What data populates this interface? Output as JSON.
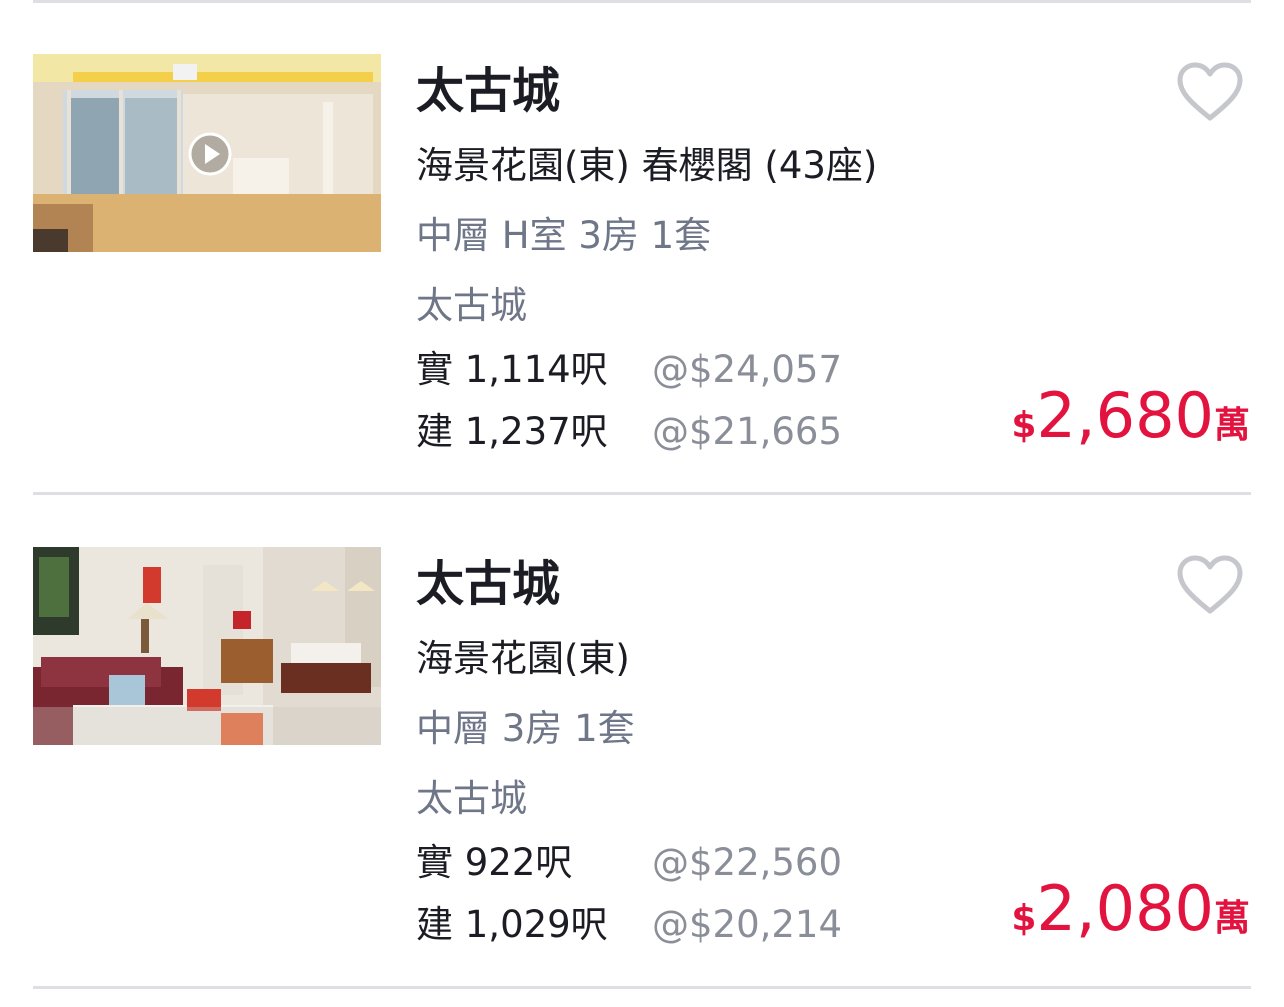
{
  "listings": [
    {
      "estate": "太古城",
      "building": "海景花園(東) 春櫻閣 (43座)",
      "details": "中層 H室 3房 1套",
      "district": "太古城",
      "saleable_label": "實 1,114呎",
      "saleable_unit_price": "@$24,057",
      "gross_label": "建 1,237呎",
      "gross_unit_price": "@$21,665",
      "price_currency": "$",
      "price_amount": "2,680",
      "price_unit": "萬",
      "has_video": true,
      "thumbnail_icon": "living-room-photo"
    },
    {
      "estate": "太古城",
      "building": "海景花園(東)",
      "details": "中層 3房 1套",
      "district": "太古城",
      "saleable_label": "實 922呎",
      "saleable_unit_price": "@$22,560",
      "gross_label": "建 1,029呎",
      "gross_unit_price": "@$20,214",
      "price_currency": "$",
      "price_amount": "2,080",
      "price_unit": "萬",
      "has_video": false,
      "thumbnail_icon": "living-room-photo"
    }
  ],
  "colors": {
    "price": "#e3133f",
    "title": "#1c1c24",
    "secondary": "#6e7688",
    "unit_price": "#8a8e98",
    "divider": "#dedfe3",
    "heart_outline": "#c6c7cc"
  },
  "icons": {
    "favorite": "heart-outline-icon",
    "video": "play-icon"
  }
}
